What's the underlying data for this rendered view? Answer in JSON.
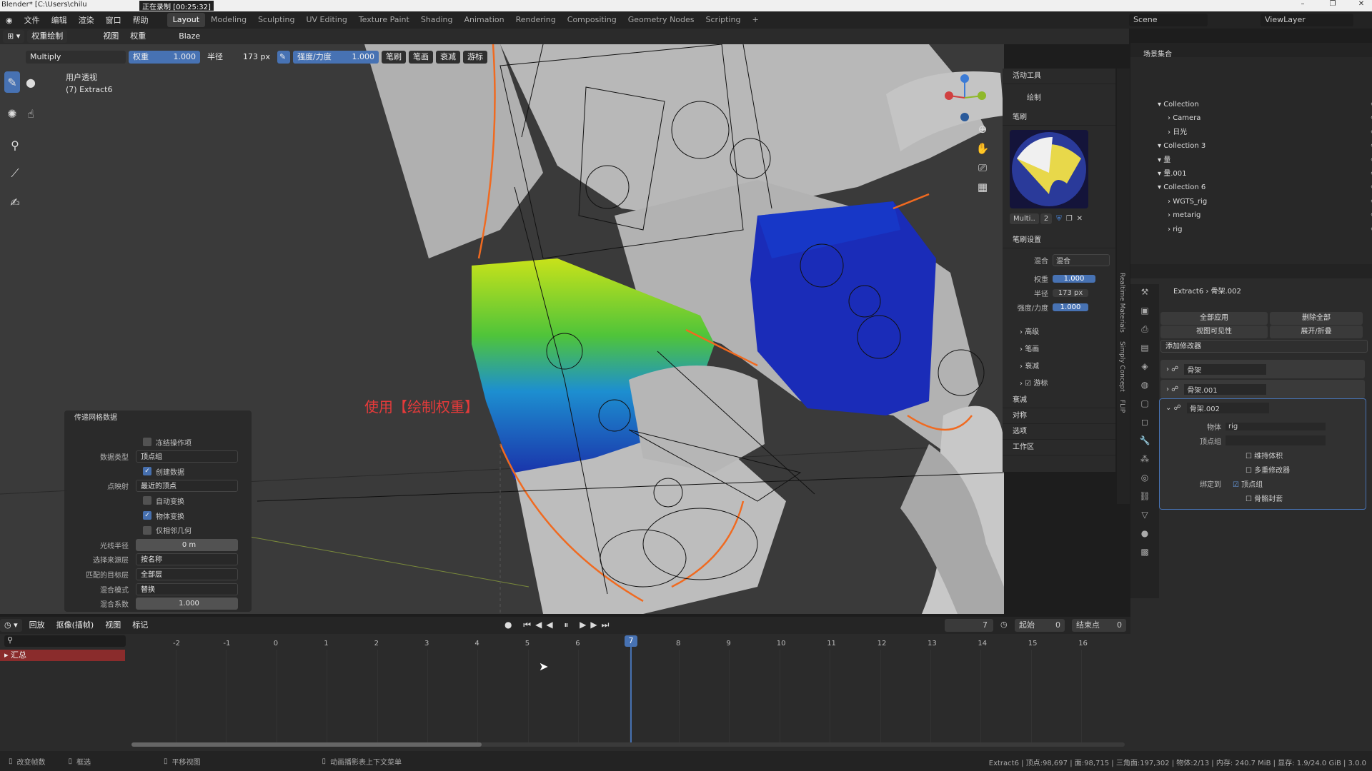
{
  "titlebar": {
    "app": "Blender* [C:\\Users\\chilu",
    "recording": "正在录制 [00:25:32]"
  },
  "menu": [
    "文件",
    "编辑",
    "渲染",
    "窗口",
    "帮助"
  ],
  "workspaces": [
    "Layout",
    "Modeling",
    "Sculpting",
    "UV Editing",
    "Texture Paint",
    "Shading",
    "Animation",
    "Rendering",
    "Compositing",
    "Geometry Nodes",
    "Scripting",
    "+"
  ],
  "scene": "Scene",
  "viewlayer": "ViewLayer",
  "header1": {
    "mode": "权重绘制",
    "view": "视图",
    "weight": "权重",
    "brush": "Blaze"
  },
  "header2": {
    "blend": "Multiply",
    "weight_label": "权重",
    "weight_val": "1.000",
    "radius_label": "半径",
    "radius_val": "173 px",
    "strength_label": "强度/力度",
    "strength_val": "1.000",
    "menus": [
      "笔刷",
      "笔画",
      "衰减",
      "游标"
    ]
  },
  "viewinfo": {
    "line1": "用户透视",
    "line2": "(7) Extract6"
  },
  "annotation": "使用【绘制权重】",
  "op_panel": {
    "title": "传递网格数据",
    "rows": [
      {
        "type": "check",
        "on": false,
        "label": "冻结操作项"
      },
      {
        "type": "drop",
        "label": "数据类型",
        "value": "顶点组"
      },
      {
        "type": "check",
        "on": true,
        "label": "创建数据"
      },
      {
        "type": "drop",
        "label": "点映射",
        "value": "最近的顶点"
      },
      {
        "type": "check",
        "on": false,
        "label": "自动变换"
      },
      {
        "type": "check",
        "on": true,
        "label": "物体变换"
      },
      {
        "type": "check",
        "on": false,
        "label": "仅相邻几何"
      },
      {
        "type": "box",
        "label": "光线半径",
        "value": "0 m"
      },
      {
        "type": "drop",
        "label": "选择来源层",
        "value": "按名称"
      },
      {
        "type": "drop",
        "label": "匹配的目标层",
        "value": "全部层"
      },
      {
        "type": "drop",
        "label": "混合模式",
        "value": "替换"
      },
      {
        "type": "box",
        "label": "混合系数",
        "value": "1.000"
      }
    ]
  },
  "npanel": {
    "active_tool": "活动工具",
    "draw": "绘制",
    "brush": "笔刷",
    "brush_name": "Multi..",
    "brush_users": "2",
    "brush_settings": "笔刷设置",
    "blend_label": "混合",
    "blend_val": "混合",
    "weight_label": "权重",
    "weight_val": "1.000",
    "radius_label": "半径",
    "radius_val": "173 px",
    "strength_label": "强度/力度",
    "strength_val": "1.000",
    "sub": [
      "高级",
      "笔画",
      "衰减",
      "游标"
    ],
    "sections": [
      "衰减",
      "对称",
      "选项",
      "工作区"
    ]
  },
  "vtabs": [
    "Realtime Materials",
    "Simply Concept",
    "FLIP"
  ],
  "outliner": {
    "root": "场景集合",
    "items": [
      {
        "name": "Collection",
        "indent": 0
      },
      {
        "name": "Camera",
        "indent": 1
      },
      {
        "name": "日光",
        "indent": 1
      },
      {
        "name": "Collection 3",
        "indent": 0
      },
      {
        "name": "量",
        "indent": 0
      },
      {
        "name": "量.001",
        "indent": 0
      },
      {
        "name": "Collection 6",
        "indent": 0
      },
      {
        "name": "WGTS_rig",
        "indent": 1
      },
      {
        "name": "metarig",
        "indent": 1
      },
      {
        "name": "rig",
        "indent": 1
      }
    ]
  },
  "props": {
    "object": "Extract6",
    "modifier": "骨架.002",
    "apply_all": "全部应用",
    "delete_all": "删除全部",
    "viewport_vis": "视图可见性",
    "expand": "展开/折叠",
    "add_modifier": "添加修改器",
    "mods": [
      "骨架",
      "骨架.001",
      "骨架.002"
    ],
    "obj_label": "物体",
    "obj_val": "rig",
    "vgroup_label": "顶点组",
    "preserve": "维持体积",
    "multi": "多重修改器",
    "bind_label": "绑定到",
    "bind_vg": "顶点组",
    "bind_env": "骨骼封套"
  },
  "timeline": {
    "menus": [
      "回放",
      "抠像(插帧)",
      "视图",
      "标记"
    ],
    "frame": "7",
    "start_label": "起始",
    "start": "0",
    "end_label": "结束点",
    "end": "0",
    "summary": "汇总",
    "ticks": [
      "-2",
      "-1",
      "0",
      "1",
      "2",
      "3",
      "4",
      "5",
      "6",
      "7",
      "8",
      "9",
      "10",
      "11",
      "12",
      "13",
      "14",
      "15",
      "16"
    ]
  },
  "status": {
    "a": "改变帧数",
    "b": "框选",
    "c": "平移视图",
    "d": "动画播影表上下文菜单",
    "info": "Extract6 | 顶点:98,697 | 面:98,715 | 三角面:197,302 | 物体:2/13 | 内存: 240.7 MiB | 显存: 1.9/24.0 GiB | 3.0.0"
  }
}
